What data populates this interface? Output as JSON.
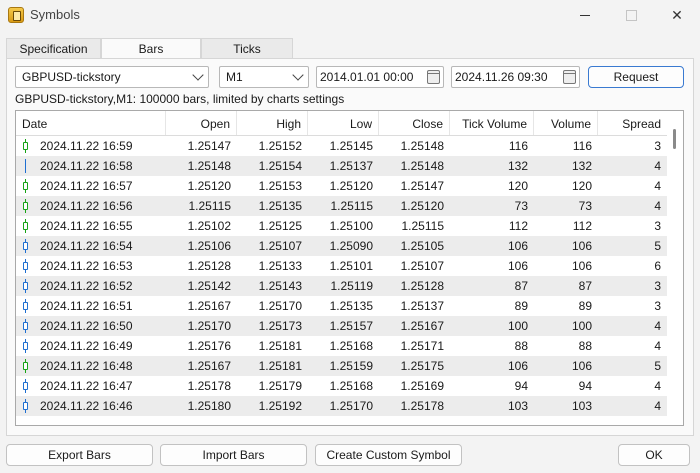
{
  "window": {
    "title": "Symbols"
  },
  "tabs": [
    {
      "label": "Specification",
      "active": false
    },
    {
      "label": "Bars",
      "active": true
    },
    {
      "label": "Ticks",
      "active": false
    }
  ],
  "controls": {
    "symbol": "GBPUSD-tickstory",
    "timeframe": "M1",
    "date_from": "2014.01.01 00:00",
    "date_to": "2024.11.26 09:30",
    "request_label": "Request"
  },
  "info_text": "GBPUSD-tickstory,M1: 100000 bars, limited by charts settings",
  "table": {
    "columns": [
      "Date",
      "Open",
      "High",
      "Low",
      "Close",
      "Tick Volume",
      "Volume",
      "Spread"
    ],
    "rows": [
      [
        "2024.11.22 16:59",
        "1.25147",
        "1.25152",
        "1.25145",
        "1.25148",
        "116",
        "116",
        "3"
      ],
      [
        "2024.11.22 16:58",
        "1.25148",
        "1.25154",
        "1.25137",
        "1.25148",
        "132",
        "132",
        "4"
      ],
      [
        "2024.11.22 16:57",
        "1.25120",
        "1.25153",
        "1.25120",
        "1.25147",
        "120",
        "120",
        "4"
      ],
      [
        "2024.11.22 16:56",
        "1.25115",
        "1.25135",
        "1.25115",
        "1.25120",
        "73",
        "73",
        "4"
      ],
      [
        "2024.11.22 16:55",
        "1.25102",
        "1.25125",
        "1.25100",
        "1.25115",
        "112",
        "112",
        "3"
      ],
      [
        "2024.11.22 16:54",
        "1.25106",
        "1.25107",
        "1.25090",
        "1.25105",
        "106",
        "106",
        "5"
      ],
      [
        "2024.11.22 16:53",
        "1.25128",
        "1.25133",
        "1.25101",
        "1.25107",
        "106",
        "106",
        "6"
      ],
      [
        "2024.11.22 16:52",
        "1.25142",
        "1.25143",
        "1.25119",
        "1.25128",
        "87",
        "87",
        "3"
      ],
      [
        "2024.11.22 16:51",
        "1.25167",
        "1.25170",
        "1.25135",
        "1.25137",
        "89",
        "89",
        "3"
      ],
      [
        "2024.11.22 16:50",
        "1.25170",
        "1.25173",
        "1.25157",
        "1.25167",
        "100",
        "100",
        "4"
      ],
      [
        "2024.11.22 16:49",
        "1.25176",
        "1.25181",
        "1.25168",
        "1.25171",
        "88",
        "88",
        "4"
      ],
      [
        "2024.11.22 16:48",
        "1.25167",
        "1.25181",
        "1.25159",
        "1.25175",
        "106",
        "106",
        "5"
      ],
      [
        "2024.11.22 16:47",
        "1.25178",
        "1.25179",
        "1.25168",
        "1.25169",
        "94",
        "94",
        "4"
      ],
      [
        "2024.11.22 16:46",
        "1.25180",
        "1.25192",
        "1.25170",
        "1.25178",
        "103",
        "103",
        "4"
      ]
    ],
    "candle_colors": {
      "bull": "#16a316",
      "bear": "#1f6fd1",
      "doji": "#1f6fd1"
    }
  },
  "buttons": {
    "export_bars": "Export Bars",
    "import_bars": "Import Bars",
    "create_custom_symbol": "Create Custom Symbol",
    "ok": "OK"
  }
}
